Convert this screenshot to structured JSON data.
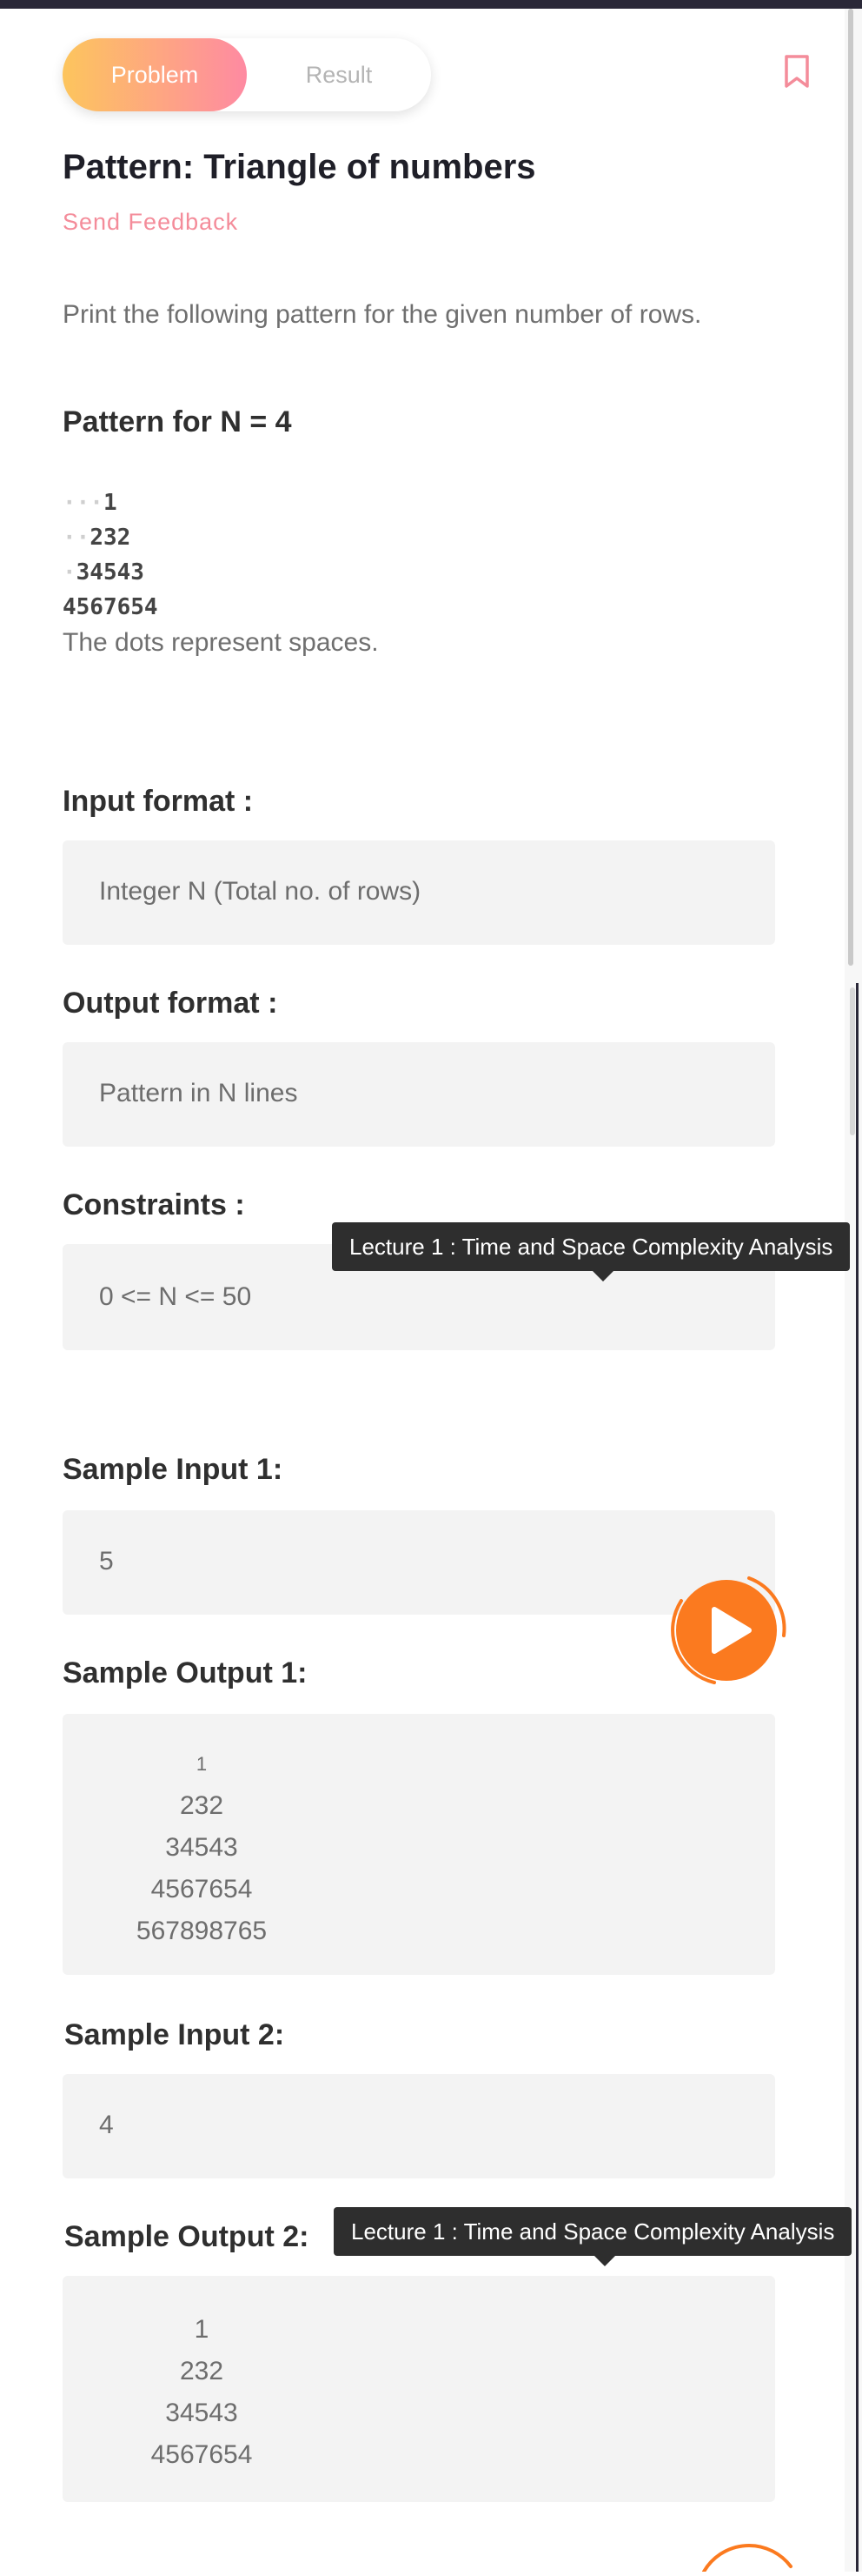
{
  "tabs": {
    "problem": "Problem",
    "result": "Result"
  },
  "problem": {
    "title": "Pattern: Triangle of numbers",
    "feedback": "Send Feedback",
    "description": "Print the following pattern for the given number of rows.",
    "pattern_heading": "Pattern for N = 4",
    "pattern_rows": [
      {
        "dots": "···",
        "digits": "1"
      },
      {
        "dots": "··",
        "digits": "232"
      },
      {
        "dots": "·",
        "digits": "34543"
      },
      {
        "dots": "",
        "digits": "4567654"
      }
    ],
    "dots_note": "The dots represent spaces."
  },
  "input_format": {
    "label": "Input format :",
    "value": "Integer N (Total no. of rows)"
  },
  "output_format": {
    "label": "Output format :",
    "value": "Pattern in N lines"
  },
  "constraints": {
    "label": "Constraints :",
    "value": "0 <= N <= 50"
  },
  "sample_input_1": {
    "label": "Sample Input 1:",
    "value": "5"
  },
  "sample_output_1": {
    "label": "Sample Output 1:",
    "lines": [
      "1",
      "232",
      "34543",
      "4567654",
      "567898765"
    ]
  },
  "sample_input_2": {
    "label": "Sample Input 2:",
    "value": "4"
  },
  "sample_output_2": {
    "label": "Sample Output 2:",
    "lines": [
      "1",
      "232",
      "34543",
      "4567654"
    ]
  },
  "tooltips": {
    "first": "Lecture 1 : Time and Space Complexity Analysis",
    "second": "Lecture 1 : Time and Space Complexity Analysis"
  },
  "colors": {
    "accent_start": "#fdc55d",
    "accent_end": "#fe8aa2",
    "feedback": "#f48c9a",
    "play": "#fb7a1f"
  },
  "icons": {
    "bookmark": "bookmark-icon",
    "play": "play-icon"
  }
}
